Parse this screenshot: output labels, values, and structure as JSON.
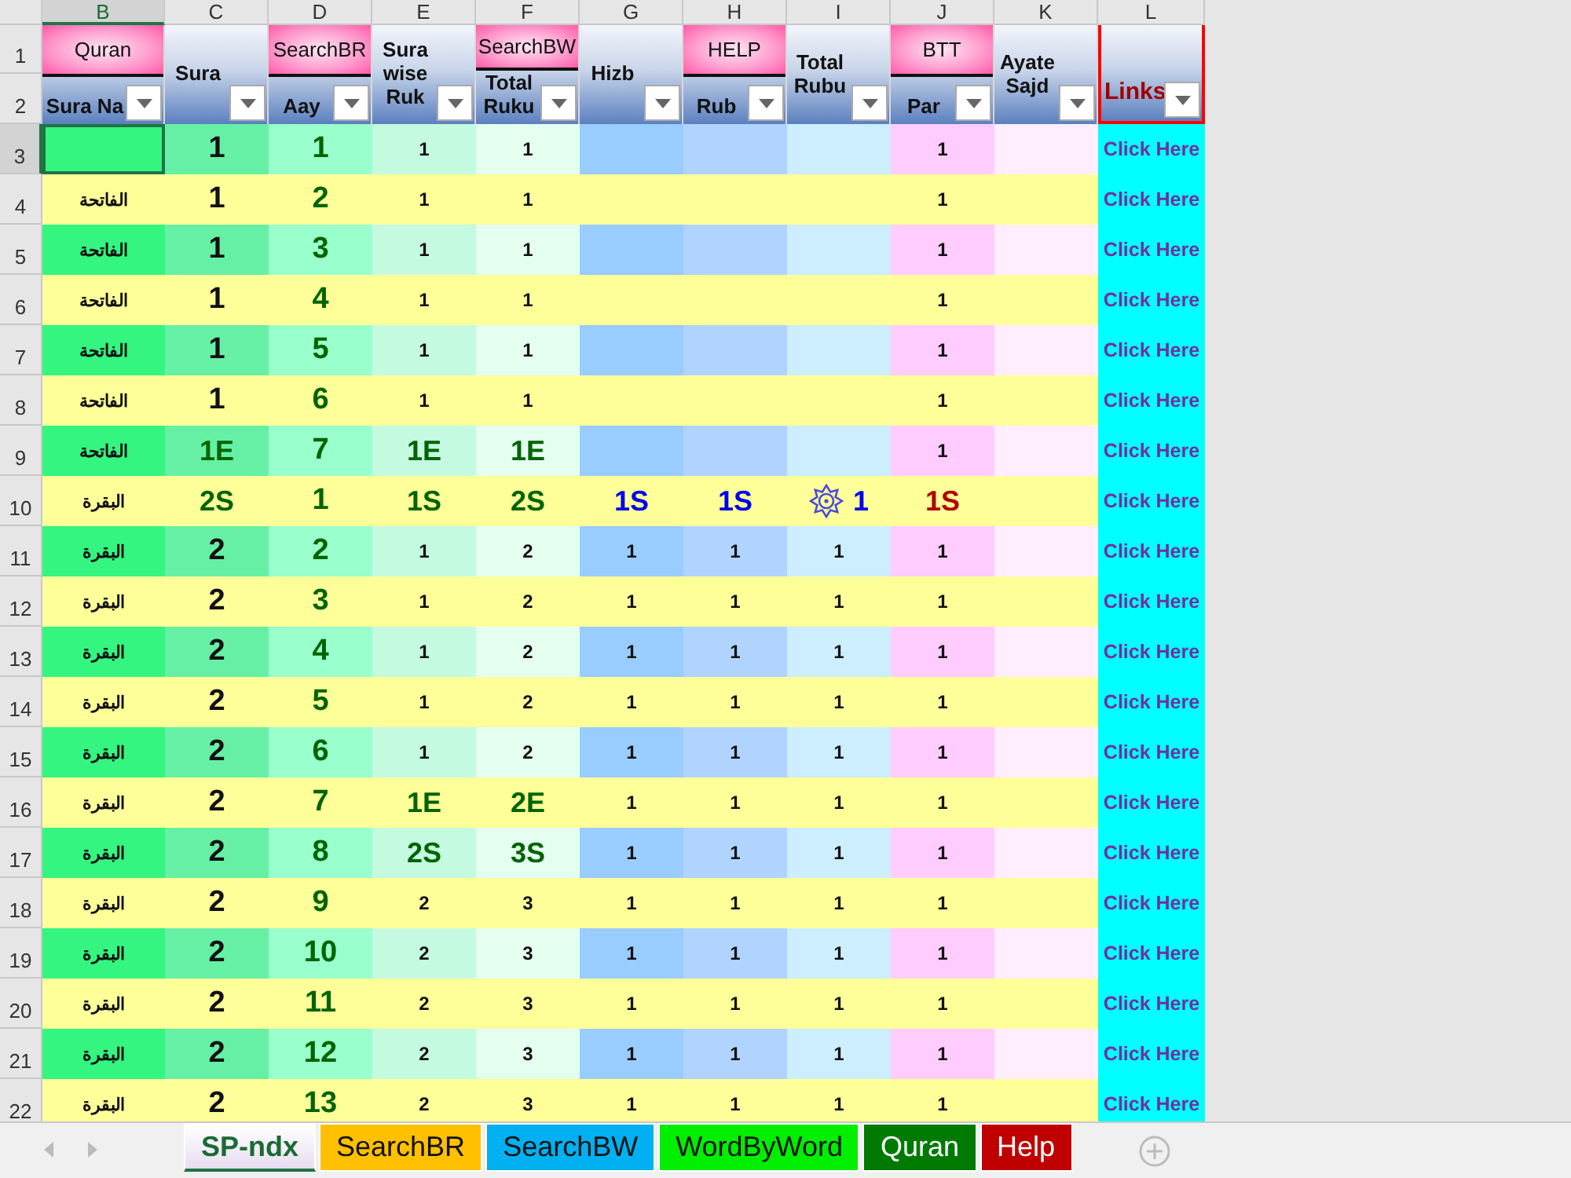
{
  "sheet": {
    "column_letters": [
      {
        "letter": "B",
        "selected": true
      },
      {
        "letter": "C",
        "selected": false
      },
      {
        "letter": "D",
        "selected": false
      },
      {
        "letter": "E",
        "selected": false
      },
      {
        "letter": "F",
        "selected": false
      },
      {
        "letter": "G",
        "selected": false
      },
      {
        "letter": "H",
        "selected": false
      },
      {
        "letter": "I",
        "selected": false
      },
      {
        "letter": "J",
        "selected": false
      },
      {
        "letter": "K",
        "selected": false
      },
      {
        "letter": "L",
        "selected": false
      }
    ],
    "header_row_numbers": [
      "1",
      "2"
    ],
    "headers": [
      {
        "kind": "split",
        "top": "Quran",
        "label": "Sura Na"
      },
      {
        "kind": "merged",
        "label": "Sura"
      },
      {
        "kind": "split",
        "top": "SearchBR",
        "label": "Aay"
      },
      {
        "kind": "merged",
        "label": "Sura wise Ruk"
      },
      {
        "kind": "split",
        "top": "SearchBW",
        "label": "Total Ruku"
      },
      {
        "kind": "merged",
        "label": "Hizb"
      },
      {
        "kind": "split",
        "top": "HELP",
        "label": "Rub"
      },
      {
        "kind": "merged",
        "label": "Total Rubu"
      },
      {
        "kind": "split",
        "top": "BTT",
        "label": "Par"
      },
      {
        "kind": "merged",
        "label": "Ayate Sajd"
      },
      {
        "kind": "links",
        "label": "Links"
      }
    ],
    "rows": [
      {
        "number": "3",
        "selected": true,
        "cells": [
          {
            "kind": "active"
          },
          "1",
          "1",
          "1",
          "1",
          null,
          null,
          null,
          "1",
          null,
          "Click Here"
        ]
      },
      {
        "number": "4",
        "cells": [
          "الفاتحة",
          "1",
          "2",
          "1",
          "1",
          null,
          null,
          null,
          "1",
          null,
          "Click Here"
        ]
      },
      {
        "number": "5",
        "cells": [
          "الفاتحة",
          "1",
          "3",
          "1",
          "1",
          null,
          null,
          null,
          "1",
          null,
          "Click Here"
        ]
      },
      {
        "number": "6",
        "cells": [
          "الفاتحة",
          "1",
          "4",
          "1",
          "1",
          null,
          null,
          null,
          "1",
          null,
          "Click Here"
        ]
      },
      {
        "number": "7",
        "cells": [
          "الفاتحة",
          "1",
          "5",
          "1",
          "1",
          null,
          null,
          null,
          "1",
          null,
          "Click Here"
        ]
      },
      {
        "number": "8",
        "cells": [
          "الفاتحة",
          "1",
          "6",
          "1",
          "1",
          null,
          null,
          null,
          "1",
          null,
          "Click Here"
        ]
      },
      {
        "number": "9",
        "cells": [
          "الفاتحة",
          {
            "kind": "marker",
            "text": "1E"
          },
          "7",
          {
            "kind": "marker",
            "text": "1E"
          },
          {
            "kind": "marker",
            "text": "1E"
          },
          null,
          null,
          null,
          "1",
          null,
          "Click Here"
        ]
      },
      {
        "number": "10",
        "cells": [
          "البقرة",
          {
            "kind": "marker",
            "text": "2S"
          },
          "1",
          {
            "kind": "marker",
            "text": "1S"
          },
          {
            "kind": "marker",
            "text": "2S"
          },
          {
            "kind": "marker",
            "text": "1S"
          },
          {
            "kind": "marker",
            "text": "1S"
          },
          {
            "kind": "marker_icon",
            "text": "1"
          },
          {
            "kind": "marker",
            "text": "1S"
          },
          null,
          "Click Here"
        ]
      },
      {
        "number": "11",
        "cells": [
          "البقرة",
          "2",
          "2",
          "1",
          "2",
          "1",
          "1",
          "1",
          "1",
          null,
          "Click Here"
        ]
      },
      {
        "number": "12",
        "cells": [
          "البقرة",
          "2",
          "3",
          "1",
          "2",
          "1",
          "1",
          "1",
          "1",
          null,
          "Click Here"
        ]
      },
      {
        "number": "13",
        "cells": [
          "البقرة",
          "2",
          "4",
          "1",
          "2",
          "1",
          "1",
          "1",
          "1",
          null,
          "Click Here"
        ]
      },
      {
        "number": "14",
        "cells": [
          "البقرة",
          "2",
          "5",
          "1",
          "2",
          "1",
          "1",
          "1",
          "1",
          null,
          "Click Here"
        ]
      },
      {
        "number": "15",
        "cells": [
          "البقرة",
          "2",
          "6",
          "1",
          "2",
          "1",
          "1",
          "1",
          "1",
          null,
          "Click Here"
        ]
      },
      {
        "number": "16",
        "cells": [
          "البقرة",
          "2",
          "7",
          {
            "kind": "marker",
            "text": "1E"
          },
          {
            "kind": "marker",
            "text": "2E"
          },
          "1",
          "1",
          "1",
          "1",
          null,
          "Click Here"
        ]
      },
      {
        "number": "17",
        "cells": [
          "البقرة",
          "2",
          "8",
          {
            "kind": "marker",
            "text": "2S"
          },
          {
            "kind": "marker",
            "text": "3S"
          },
          "1",
          "1",
          "1",
          "1",
          null,
          "Click Here"
        ]
      },
      {
        "number": "18",
        "cells": [
          "البقرة",
          "2",
          "9",
          "2",
          "3",
          "1",
          "1",
          "1",
          "1",
          null,
          "Click Here"
        ]
      },
      {
        "number": "19",
        "cells": [
          "البقرة",
          "2",
          "10",
          "2",
          "3",
          "1",
          "1",
          "1",
          "1",
          null,
          "Click Here"
        ]
      },
      {
        "number": "20",
        "cells": [
          "البقرة",
          "2",
          "11",
          "2",
          "3",
          "1",
          "1",
          "1",
          "1",
          null,
          "Click Here"
        ]
      },
      {
        "number": "21",
        "cells": [
          "البقرة",
          "2",
          "12",
          "2",
          "3",
          "1",
          "1",
          "1",
          "1",
          null,
          "Click Here"
        ]
      },
      {
        "number": "22",
        "cells": [
          "البقرة",
          "2",
          "13",
          "2",
          "3",
          "1",
          "1",
          "1",
          "1",
          null,
          "Click Here"
        ]
      }
    ]
  },
  "sheet_tabs": [
    {
      "label": "SP-ndx",
      "selected": true,
      "color": "#e6ddf0"
    },
    {
      "label": "SearchBR",
      "selected": false,
      "color": "#ffc000"
    },
    {
      "label": "SearchBW",
      "selected": false,
      "color": "#00b0f0"
    },
    {
      "label": "WordByWord",
      "selected": false,
      "color": "#00ee00"
    },
    {
      "label": "Quran",
      "selected": false,
      "color": "#007a00"
    },
    {
      "label": "Help",
      "selected": false,
      "color": "#c00000"
    }
  ]
}
